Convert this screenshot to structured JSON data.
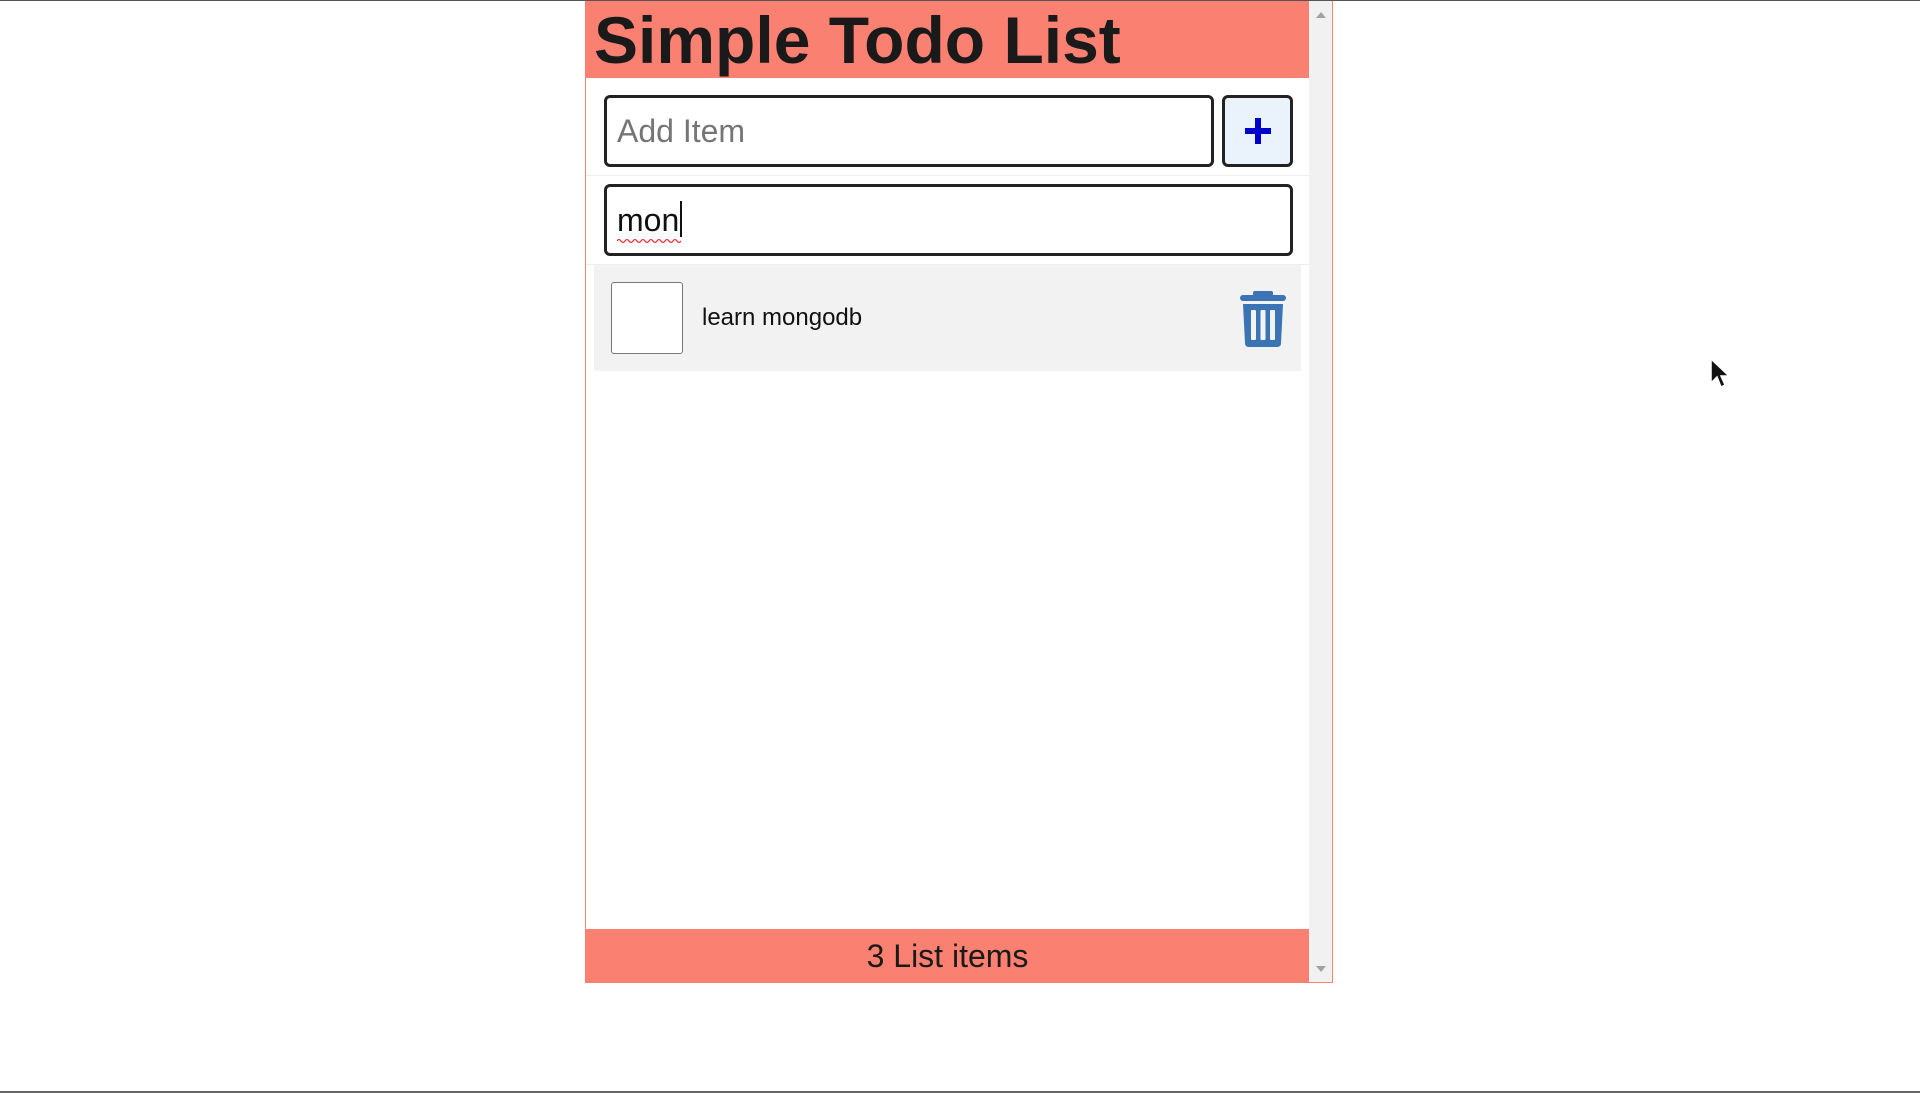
{
  "header": {
    "title": "Simple Todo List"
  },
  "add_form": {
    "placeholder": "Add Item",
    "value": "",
    "button_icon": "plus-icon",
    "icon_color": "#0000cc"
  },
  "search_form": {
    "value": "mon"
  },
  "items": [
    {
      "label": "learn mongodb",
      "checked": false,
      "delete_icon": "trash-icon"
    }
  ],
  "footer": {
    "text": "3 List items"
  },
  "colors": {
    "accent": "#fa8072",
    "trash": "#3a74b4",
    "item_bg": "#f2f2f2"
  }
}
